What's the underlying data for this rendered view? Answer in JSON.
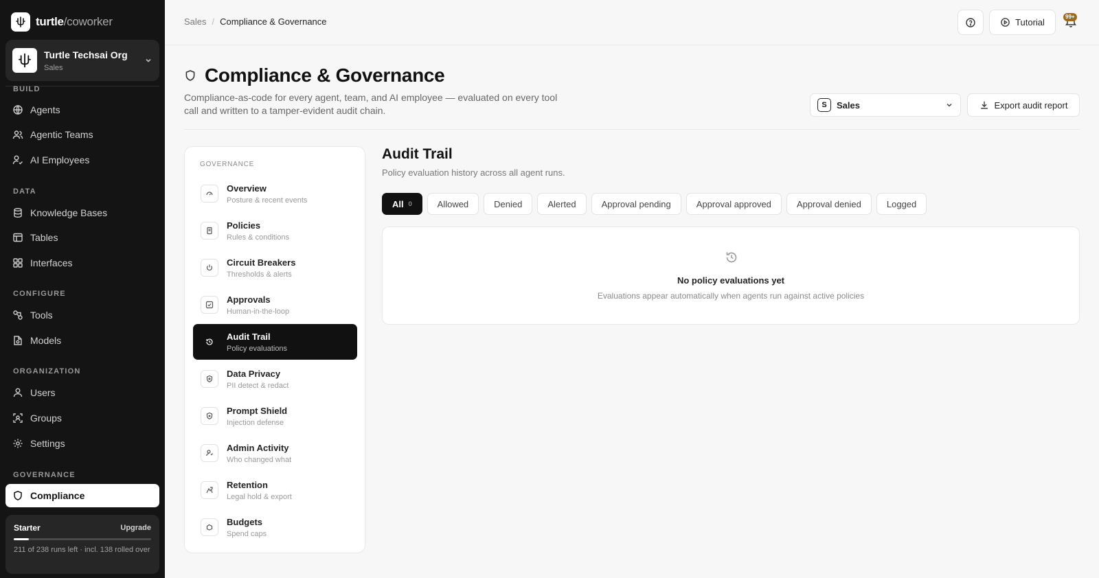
{
  "app": {
    "brand": "turtle",
    "product": "/coworker"
  },
  "org": {
    "name": "Turtle Techsai Org",
    "team": "Sales"
  },
  "sidebar": {
    "sections": [
      {
        "label": "BUILD",
        "items": [
          {
            "label": "Agents",
            "icon": "globe-icon"
          },
          {
            "label": "Agentic Teams",
            "icon": "users-icon"
          },
          {
            "label": "AI Employees",
            "icon": "user-check-icon"
          }
        ]
      },
      {
        "label": "DATA",
        "items": [
          {
            "label": "Knowledge Bases",
            "icon": "database-icon"
          },
          {
            "label": "Tables",
            "icon": "table-icon"
          },
          {
            "label": "Interfaces",
            "icon": "layout-icon"
          }
        ]
      },
      {
        "label": "CONFIGURE",
        "items": [
          {
            "label": "Tools",
            "icon": "tools-icon"
          },
          {
            "label": "Models",
            "icon": "model-icon"
          }
        ]
      },
      {
        "label": "ORGANIZATION",
        "items": [
          {
            "label": "Users",
            "icon": "user-icon"
          },
          {
            "label": "Groups",
            "icon": "group-icon"
          },
          {
            "label": "Settings",
            "icon": "gear-icon"
          }
        ]
      },
      {
        "label": "GOVERNANCE",
        "items": [
          {
            "label": "Compliance",
            "icon": "shield-icon",
            "active": true
          }
        ]
      }
    ]
  },
  "plan": {
    "name": "Starter",
    "upgrade_label": "Upgrade",
    "usage_fraction": 0.11,
    "note": "211 of 238 runs left · incl. 138 rolled over"
  },
  "topbar": {
    "breadcrumb": [
      "Sales",
      "Compliance & Governance"
    ],
    "breadcrumb_separator": "/",
    "tutorial_label": "Tutorial",
    "notification_badge": "99+"
  },
  "page": {
    "title": "Compliance & Governance",
    "description": "Compliance-as-code for every agent, team, and AI employee — evaluated on every tool call and written to a tamper-evident audit chain.",
    "scope": {
      "letter": "S",
      "label": "Sales"
    },
    "export_label": "Export audit report"
  },
  "governance_nav": {
    "title": "GOVERNANCE",
    "items": [
      {
        "label": "Overview",
        "sub": "Posture & recent events",
        "icon": "gauge-icon"
      },
      {
        "label": "Policies",
        "sub": "Rules & conditions",
        "icon": "document-icon"
      },
      {
        "label": "Circuit Breakers",
        "sub": "Thresholds & alerts",
        "icon": "power-icon"
      },
      {
        "label": "Approvals",
        "sub": "Human-in-the-loop",
        "icon": "check-square-icon"
      },
      {
        "label": "Audit Trail",
        "sub": "Policy evaluations",
        "icon": "history-icon",
        "active": true
      },
      {
        "label": "Data Privacy",
        "sub": "PII detect & redact",
        "icon": "privacy-shield-icon"
      },
      {
        "label": "Prompt Shield",
        "sub": "Injection defense",
        "icon": "prompt-shield-icon"
      },
      {
        "label": "Admin Activity",
        "sub": "Who changed what",
        "icon": "admin-user-icon"
      },
      {
        "label": "Retention",
        "sub": "Legal hold & export",
        "icon": "archive-icon"
      },
      {
        "label": "Budgets",
        "sub": "Spend caps",
        "icon": "wallet-icon"
      }
    ]
  },
  "audit": {
    "title": "Audit Trail",
    "subtitle": "Policy evaluation history across all agent runs.",
    "filters": [
      {
        "label": "All",
        "count": "0",
        "active": true
      },
      {
        "label": "Allowed"
      },
      {
        "label": "Denied"
      },
      {
        "label": "Alerted"
      },
      {
        "label": "Approval pending"
      },
      {
        "label": "Approval approved"
      },
      {
        "label": "Approval denied"
      },
      {
        "label": "Logged"
      }
    ],
    "empty_title": "No policy evaluations yet",
    "empty_sub": "Evaluations appear automatically when agents run against active policies"
  },
  "colors": {
    "sidebar_bg": "#141414",
    "active_bg": "#111111",
    "page_bg": "#f7f7f7",
    "badge": "#9b6a1c"
  }
}
